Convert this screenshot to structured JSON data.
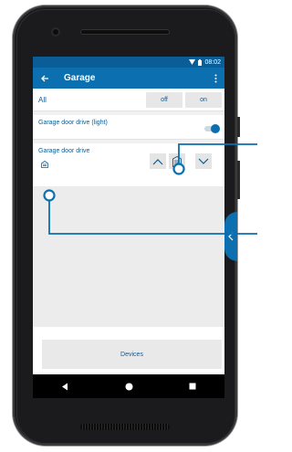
{
  "status_bar": {
    "time": "08:02"
  },
  "app_bar": {
    "title": "Garage"
  },
  "all_row": {
    "label": "All",
    "off_label": "off",
    "on_label": "on"
  },
  "light_row": {
    "label": "Garage door drive (light)",
    "toggle_state": "on"
  },
  "garage_row": {
    "label": "Garage door drive"
  },
  "devices_button": {
    "label": "Devices"
  },
  "colors": {
    "primary": "#0b6fb0",
    "status": "#0a5d96",
    "text_accent": "#0a5d96"
  },
  "icons": {
    "back": "arrow-left-icon",
    "menu": "more-vertical-icon",
    "up": "chevron-up-icon",
    "stop": "garage-door-icon",
    "down": "chevron-down-icon",
    "small_garage": "garage-icon",
    "side_tab": "chevron-left-icon",
    "nav_back": "triangle-back-icon",
    "nav_home": "circle-home-icon",
    "nav_recent": "square-recent-icon"
  }
}
